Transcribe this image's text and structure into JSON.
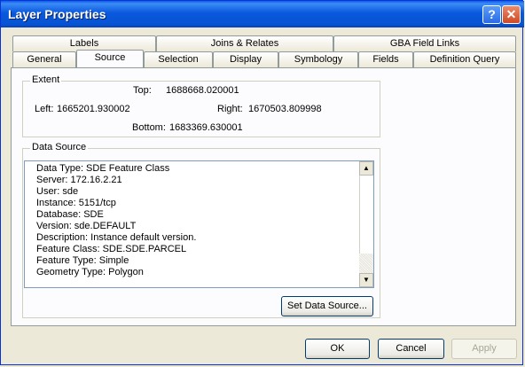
{
  "window": {
    "title": "Layer Properties"
  },
  "tabs_row1": [
    {
      "label": "Labels"
    },
    {
      "label": "Joins & Relates"
    },
    {
      "label": "GBA Field Links"
    }
  ],
  "tabs_row2": [
    {
      "label": "General"
    },
    {
      "label": "Source"
    },
    {
      "label": "Selection"
    },
    {
      "label": "Display"
    },
    {
      "label": "Symbology"
    },
    {
      "label": "Fields"
    },
    {
      "label": "Definition Query"
    }
  ],
  "active_tab": "Source",
  "extent": {
    "title": "Extent",
    "top_label": "Top:",
    "top_value": "1688668.020001",
    "left_label": "Left:",
    "left_value": "1665201.930002",
    "right_label": "Right:",
    "right_value": "1670503.809998",
    "bottom_label": "Bottom:",
    "bottom_value": "1683369.630001"
  },
  "data_source": {
    "title": "Data Source",
    "lines": [
      "Data Type: SDE Feature Class",
      "Server: 172.16.2.21",
      "User:  sde",
      "Instance: 5151/tcp",
      "Database: SDE",
      "Version: sde.DEFAULT",
      "Description: Instance default version.",
      "Feature Class: SDE.SDE.PARCEL",
      "Feature Type: Simple",
      "Geometry Type: Polygon"
    ],
    "set_button": "Set Data Source..."
  },
  "buttons": {
    "ok": "OK",
    "cancel": "Cancel",
    "apply": "Apply"
  }
}
